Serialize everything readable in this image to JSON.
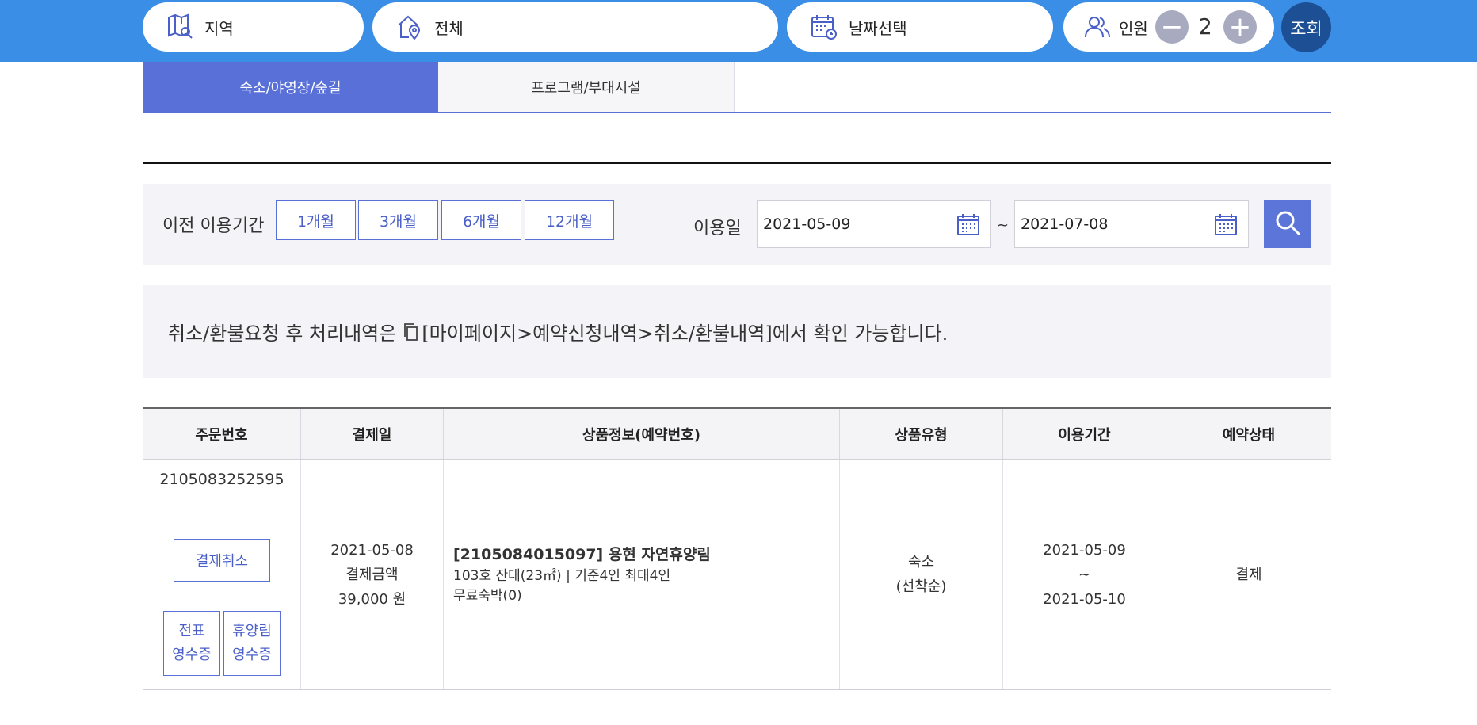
{
  "top_search": {
    "region_label": "지역",
    "all_label": "전체",
    "date_label": "날짜선택",
    "people_label": "인원",
    "people_count": "2",
    "minus_label": "−",
    "plus_label": "+",
    "search_label": "조회"
  },
  "tabs": [
    {
      "label": "숙소/야영장/숲길",
      "active": true
    },
    {
      "label": "프로그램/부대시설",
      "active": false
    }
  ],
  "filter": {
    "prev_period_label": "이전 이용기간",
    "periods": [
      "1개월",
      "3개월",
      "6개월",
      "12개월"
    ],
    "use_date_label": "이용일",
    "start_date": "2021-05-09",
    "tilde": "~",
    "end_date": "2021-07-08"
  },
  "notice": {
    "prefix": "취소/환불요청 후 처리내역은",
    "link_text": "[마이페이지>예약신청내역>취소/환불내역]에서 확인 가능합니다."
  },
  "table": {
    "headers": [
      "주문번호",
      "결제일",
      "상품정보(예약번호)",
      "상품유형",
      "이용기간",
      "예약상태"
    ],
    "rows": [
      {
        "order_no": "2105083252595",
        "cancel_label": "결제취소",
        "receipt1": [
          "전표",
          "영수증"
        ],
        "receipt2": [
          "휴양림",
          "영수증"
        ],
        "pay_date": "2021-05-08",
        "amount_label": "결제금액",
        "amount": "39,000 원",
        "product_name": "[2105084015097] 용현 자연휴양림",
        "product_detail": "103호 잔대(23㎡) | 기준4인 최대4인",
        "product_extra": "무료숙박(0)",
        "type_line1": "숙소",
        "type_line2": "(선착순)",
        "period_start": "2021-05-09",
        "period_sep": "~",
        "period_end": "2021-05-10",
        "status": "결제"
      }
    ]
  },
  "colors": {
    "topbar": "#3a8ee6",
    "accent": "#5870d8",
    "search_dark": "#1d4f95"
  }
}
